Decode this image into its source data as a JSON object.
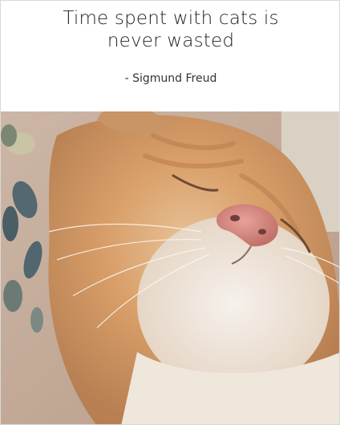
{
  "quote": {
    "line1": "Time spent with cats is",
    "line2": "never wasted"
  },
  "author": "- Sigmund Freud",
  "photo": {
    "subject": "sleeping-kitten-photo"
  },
  "colors": {
    "background": "#ffffff",
    "text": "#222222",
    "fur_orange": "#d9a06a",
    "fur_white": "#f1ebe4",
    "nose_pink": "#d7897f"
  }
}
